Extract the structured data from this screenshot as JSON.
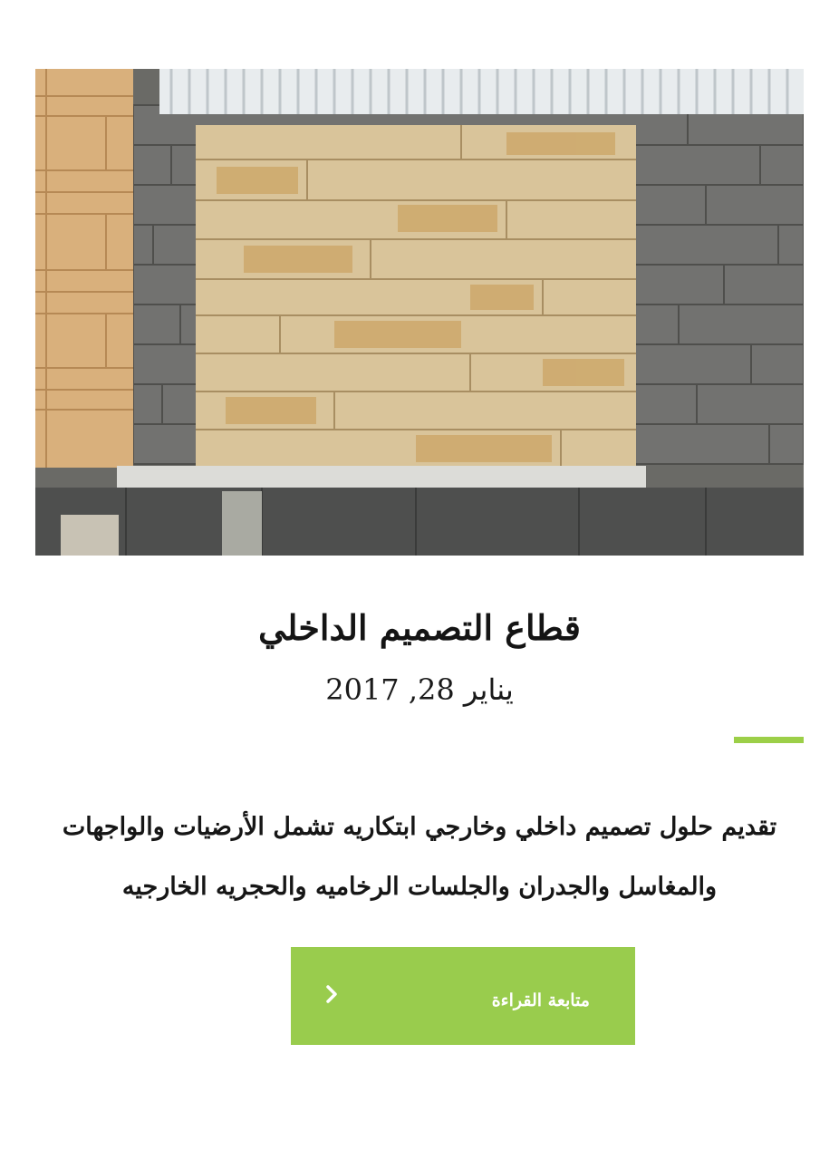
{
  "post": {
    "title": "قطاع التصميم الداخلي",
    "date": "يناير 28, 2017",
    "excerpt": "تقديم حلول تصميم داخلي وخارجي ابتكاريه تشمل الأرضيات والواجهات والمغاسل والجدران والجلسات الرخاميه والحجريه الخارجيه",
    "read_more_label": "متابعة القراءة",
    "read_more_icon": "chevron-right-icon"
  },
  "colors": {
    "accent": "#9ccf48",
    "button_bg": "#99cc4d",
    "button_text": "#ffffff",
    "text": "#141414"
  }
}
